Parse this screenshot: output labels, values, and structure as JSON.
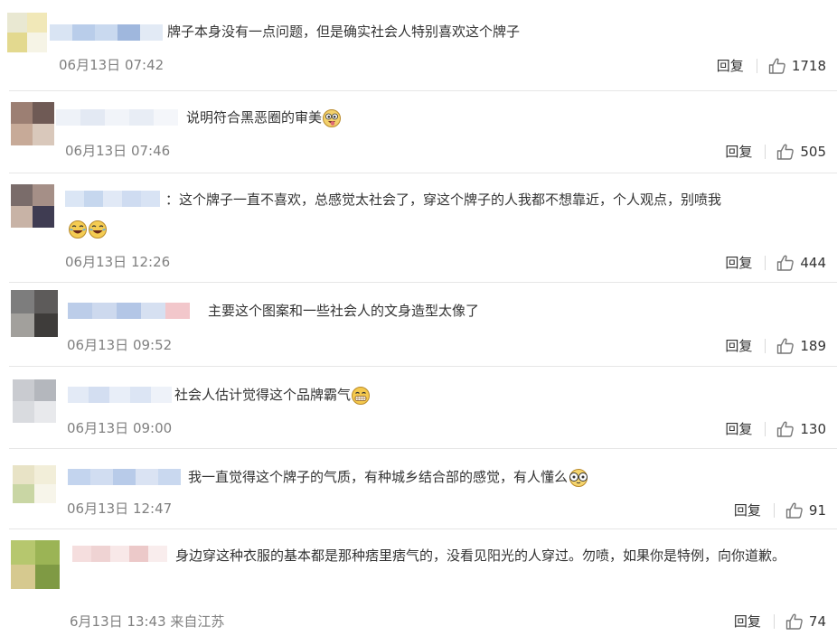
{
  "comments": [
    {
      "text": "牌子本身没有一点问题，但是确实社会人特别喜欢这个牌子",
      "time": "06月13日 07:42",
      "reply": "回复",
      "likes": "1718",
      "avatar_colors": [
        "#e9e8d2",
        "#f1e8b8",
        "#e3d98f",
        "#f6f4e6"
      ],
      "name_colors": [
        "#d9e4f3",
        "#b9cdea",
        "#c9d9ef",
        "#9fb7dd",
        "#e2eaf5"
      ]
    },
    {
      "text": "说明符合黑恶圈的审美",
      "time": "06月13日 07:46",
      "reply": "回复",
      "likes": "505",
      "emoji": [
        "tongue-out-emoji"
      ],
      "avatar_colors": [
        "#9c7f73",
        "#6f5a55",
        "#c7aa98",
        "#d9c8bb"
      ],
      "name_colors": [
        "#eef2f8",
        "#e3e9f3",
        "#f1f4f9",
        "#e8edf5",
        "#f4f6fa"
      ]
    },
    {
      "text": "：这个牌子一直不喜欢，总感觉太社会了，穿这个牌子的人我都不想靠近，个人观点，别喷我",
      "time": "06月13日 12:26",
      "reply": "回复",
      "likes": "444",
      "emoji": [
        "laugh-cry-emoji",
        "laugh-cry-emoji"
      ],
      "avatar_colors": [
        "#7a6c6a",
        "#a58f87",
        "#c8b3a6",
        "#3f3c52"
      ],
      "name_colors": [
        "#dbe6f5",
        "#c6d7ee",
        "#e1e9f6",
        "#cfdcf1",
        "#d8e3f4"
      ]
    },
    {
      "text": "主要这个图案和一些社会人的文身造型太像了",
      "time": "06月13日 09:52",
      "reply": "回复",
      "likes": "189",
      "avatar_colors": [
        "#7d7d7d",
        "#5d5b5a",
        "#a2a09c",
        "#3e3c3a"
      ],
      "name_colors": [
        "#bccde9",
        "#cdd9ee",
        "#b3c6e6",
        "#d6e0f1",
        "#f2c7cb"
      ]
    },
    {
      "text": "社会人估计觉得这个品牌霸气",
      "time": "06月13日 09:00",
      "reply": "回复",
      "likes": "130",
      "emoji": [
        "grin-emoji"
      ],
      "avatar_colors": [
        "#c9cbd0",
        "#b4b7bd",
        "#d9dbdf",
        "#e8e9ec"
      ],
      "name_colors": [
        "#e3eaf6",
        "#d3def1",
        "#e8eef8",
        "#dce5f4",
        "#eef2f9"
      ]
    },
    {
      "text": "我一直觉得这个牌子的气质，有种城乡结合部的感觉，有人懂么",
      "time": "06月13日 12:47",
      "reply": "回复",
      "likes": "91",
      "emoji": [
        "glasses-emoji"
      ],
      "avatar_colors": [
        "#e8e3c6",
        "#f2eed9",
        "#c9d6a4",
        "#f7f5ea"
      ],
      "name_colors": [
        "#c3d4ee",
        "#d1ddf1",
        "#b8cbe9",
        "#dae3f3",
        "#c9d8ef"
      ]
    },
    {
      "text": "身边穿这种衣服的基本都是那种痞里痞气的，没看见阳光的人穿过。勿喷，如果你是特例，向你道歉。",
      "time": "6月13日 13:43 来自江苏",
      "reply": "回复",
      "likes": "74",
      "avatar_colors": [
        "#b6c76e",
        "#9bb455",
        "#d6c98f",
        "#7f9a44"
      ],
      "name_colors": [
        "#f5dede",
        "#efd3d3",
        "#f8e8e8",
        "#ecc9c9",
        "#f9eded"
      ]
    }
  ]
}
